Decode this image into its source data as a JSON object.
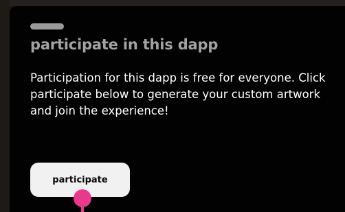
{
  "dialog": {
    "title": "participate in this dapp",
    "description": "Participation for this dapp is free for everyone. Click participate below to generate your custom artwork and join the experience!",
    "participate_label": "participate"
  },
  "colors": {
    "card_background": "#020202",
    "title": "#a3a3a3",
    "button_background": "#f1f1f1",
    "tour_marker": "#e8398a"
  }
}
